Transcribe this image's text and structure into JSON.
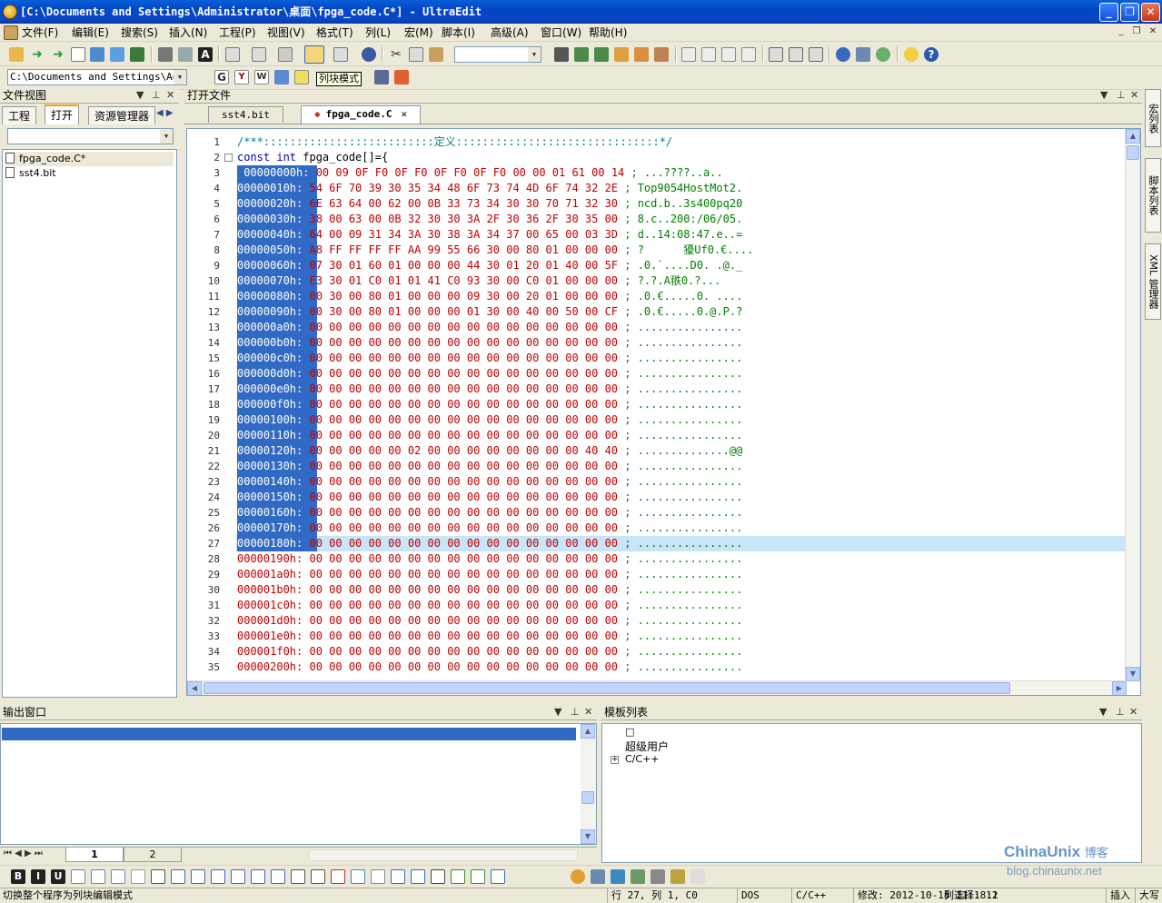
{
  "window": {
    "title": "[C:\\Documents and Settings\\Administrator\\桌面\\fpga_code.C*] - UltraEdit",
    "min_label": "_",
    "max_label": "❐",
    "close_label": "✕"
  },
  "menu": [
    "文件(F)",
    "编辑(E)",
    "搜索(S)",
    "插入(N)",
    "工程(P)",
    "视图(V)",
    "格式(T)",
    "列(L)",
    "宏(M)",
    "脚本(I)",
    "高级(A)",
    "窗口(W)",
    "帮助(H)"
  ],
  "toolbar": {
    "path_combo": "C:\\Documents and Settings\\Admi",
    "tooltip": "列块模式"
  },
  "file_view": {
    "title": "文件视图",
    "tabs": [
      "工程",
      "打开",
      "资源管理器"
    ],
    "files": [
      "fpga_code.C*",
      "sst4.bit"
    ]
  },
  "open_files": {
    "title": "打开文件",
    "tabs": [
      "sst4.bit",
      "fpga_code.C"
    ]
  },
  "editor": {
    "line_numbers": [
      "1",
      "2",
      "3",
      "4",
      "5",
      "6",
      "7",
      "8",
      "9",
      "10",
      "11",
      "12",
      "13",
      "14",
      "15",
      "16",
      "17",
      "18",
      "19",
      "20",
      "21",
      "22",
      "23",
      "24",
      "25",
      "26",
      "27",
      "28",
      "29",
      "30",
      "31",
      "32",
      "33",
      "34",
      "35"
    ],
    "line1": "/***::::::::::::::::::::::::::定义:::::::::::::::::::::::::::::::*/",
    "line2_kw": "const int",
    "line2_rest": " fpga_code[]={",
    "rows": [
      {
        "addr": " 00000000h:",
        "hex": " 00 09 0F F0 0F F0 0F F0 0F F0 00 00 01 61 00 14",
        "ascii": " ; ...????..a.."
      },
      {
        "addr": "00000010h:",
        "hex": " 54 6F 70 39 30 35 34 48 6F 73 74 4D 6F 74 32 2E",
        "ascii": " ; Top9054HostMot2."
      },
      {
        "addr": "00000020h:",
        "hex": " 6E 63 64 00 62 00 0B 33 73 34 30 30 70 71 32 30",
        "ascii": " ; ncd.b..3s400pq20"
      },
      {
        "addr": "00000030h:",
        "hex": " 38 00 63 00 0B 32 30 30 3A 2F 30 36 2F 30 35 00",
        "ascii": " ; 8.c..200:/06/05."
      },
      {
        "addr": "00000040h:",
        "hex": " 64 00 09 31 34 3A 30 38 3A 34 37 00 65 00 03 3D",
        "ascii": " ; d..14:08:47.e..="
      },
      {
        "addr": "00000050h:",
        "hex": " A8 FF FF FF FF AA 99 55 66 30 00 80 01 00 00 00",
        "ascii": " ; ?      獶Uf0.€...."
      },
      {
        "addr": "00000060h:",
        "hex": " 07 30 01 60 01 00 00 00 44 30 01 20 01 40 00 5F",
        "ascii": " ; .0.`....D0. .@._"
      },
      {
        "addr": "00000070h:",
        "hex": " E3 30 01 C0 01 01 41 C0 93 30 00 C0 01 00 00 00",
        "ascii": " ; ?.?.A翐0.?..."
      },
      {
        "addr": "00000080h:",
        "hex": " 00 30 00 80 01 00 00 00 09 30 00 20 01 00 00 00",
        "ascii": " ; .0.€.....0. ...."
      },
      {
        "addr": "00000090h:",
        "hex": " 00 30 00 80 01 00 00 00 01 30 00 40 00 50 00 CF",
        "ascii": " ; .0.€.....0.@.P.?"
      },
      {
        "addr": "000000a0h:",
        "hex": " 00 00 00 00 00 00 00 00 00 00 00 00 00 00 00 00",
        "ascii": " ; ................"
      },
      {
        "addr": "000000b0h:",
        "hex": " 00 00 00 00 00 00 00 00 00 00 00 00 00 00 00 00",
        "ascii": " ; ................"
      },
      {
        "addr": "000000c0h:",
        "hex": " 00 00 00 00 00 00 00 00 00 00 00 00 00 00 00 00",
        "ascii": " ; ................"
      },
      {
        "addr": "000000d0h:",
        "hex": " 00 00 00 00 00 00 00 00 00 00 00 00 00 00 00 00",
        "ascii": " ; ................"
      },
      {
        "addr": "000000e0h:",
        "hex": " 00 00 00 00 00 00 00 00 00 00 00 00 00 00 00 00",
        "ascii": " ; ................"
      },
      {
        "addr": "000000f0h:",
        "hex": " 00 00 00 00 00 00 00 00 00 00 00 00 00 00 00 00",
        "ascii": " ; ................"
      },
      {
        "addr": "00000100h:",
        "hex": " 00 00 00 00 00 00 00 00 00 00 00 00 00 00 00 00",
        "ascii": " ; ................"
      },
      {
        "addr": "00000110h:",
        "hex": " 00 00 00 00 00 00 00 00 00 00 00 00 00 00 00 00",
        "ascii": " ; ................"
      },
      {
        "addr": "00000120h:",
        "hex": " 00 00 00 00 00 02 00 00 00 00 00 00 00 00 40 40",
        "ascii": " ; ..............@@"
      },
      {
        "addr": "00000130h:",
        "hex": " 00 00 00 00 00 00 00 00 00 00 00 00 00 00 00 00",
        "ascii": " ; ................"
      },
      {
        "addr": "00000140h:",
        "hex": " 00 00 00 00 00 00 00 00 00 00 00 00 00 00 00 00",
        "ascii": " ; ................"
      },
      {
        "addr": "00000150h:",
        "hex": " 00 00 00 00 00 00 00 00 00 00 00 00 00 00 00 00",
        "ascii": " ; ................"
      },
      {
        "addr": "00000160h:",
        "hex": " 00 00 00 00 00 00 00 00 00 00 00 00 00 00 00 00",
        "ascii": " ; ................"
      },
      {
        "addr": "00000170h:",
        "hex": " 00 00 00 00 00 00 00 00 00 00 00 00 00 00 00 00",
        "ascii": " ; ................"
      },
      {
        "addr": "00000180h:",
        "hex": " 00 00 00 00 00 00 00 00 00 00 00 00 00 00 00 00",
        "ascii": " ; ................"
      },
      {
        "addr": "00000190h:",
        "hex": " 00 00 00 00 00 00 00 00 00 00 00 00 00 00 00 00",
        "ascii": " ; ................"
      },
      {
        "addr": "000001a0h:",
        "hex": " 00 00 00 00 00 00 00 00 00 00 00 00 00 00 00 00",
        "ascii": " ; ................"
      },
      {
        "addr": "000001b0h:",
        "hex": " 00 00 00 00 00 00 00 00 00 00 00 00 00 00 00 00",
        "ascii": " ; ................"
      },
      {
        "addr": "000001c0h:",
        "hex": " 00 00 00 00 00 00 00 00 00 00 00 00 00 00 00 00",
        "ascii": " ; ................"
      },
      {
        "addr": "000001d0h:",
        "hex": " 00 00 00 00 00 00 00 00 00 00 00 00 00 00 00 00",
        "ascii": " ; ................"
      },
      {
        "addr": "000001e0h:",
        "hex": " 00 00 00 00 00 00 00 00 00 00 00 00 00 00 00 00",
        "ascii": " ; ................"
      },
      {
        "addr": "000001f0h:",
        "hex": " 00 00 00 00 00 00 00 00 00 00 00 00 00 00 00 00",
        "ascii": " ; ................"
      },
      {
        "addr": "00000200h:",
        "hex": " 00 00 00 00 00 00 00 00 00 00 00 00 00 00 00 00",
        "ascii": " ; ................"
      }
    ]
  },
  "right_dock": [
    "宏列表",
    "脚本列表",
    "XML 管理器"
  ],
  "output": {
    "title": "输出窗口",
    "tabs": [
      "1",
      "2"
    ]
  },
  "template": {
    "title": "模板列表",
    "items": [
      "□",
      "超级用户",
      "C/C++"
    ]
  },
  "status": {
    "message": "切换整个程序为列块编辑模式",
    "position": "行 27, 列 1, C0",
    "format": "DOS",
    "lang": "C/C++",
    "modified": "修改: 2012-10-18 11:18:2",
    "selection": "列选择: 11",
    "insert": "插入",
    "caps": "大写"
  },
  "watermark": {
    "brand": "ChinaUnix",
    "brand_suffix": "博客",
    "url": "blog.chinaunix.net"
  },
  "colors": {
    "title_blue": "#0a5fd8",
    "selection": "#316ac5",
    "current_line": "#c8e6f8",
    "hex_red": "#c00000",
    "ascii_green": "#008000",
    "keyword_blue": "#0000c0"
  }
}
